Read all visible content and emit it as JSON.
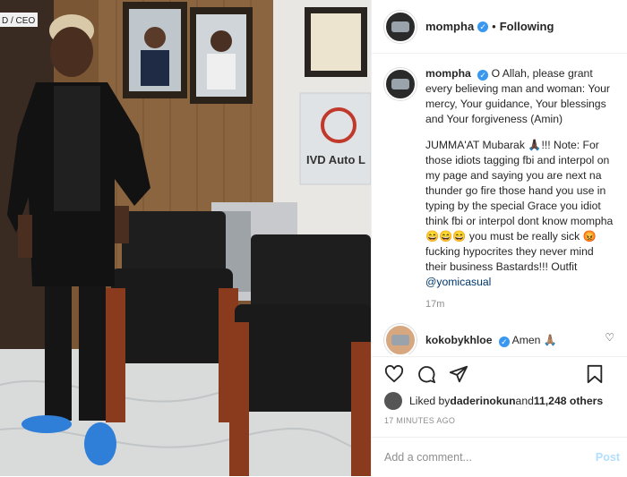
{
  "photo": {
    "sign_text": "IVD Auto L",
    "door_label": "D / CEO"
  },
  "header": {
    "username": "mompha",
    "dot": "•",
    "follow_status": "Following"
  },
  "caption": {
    "username": "mompha",
    "paragraph1": "O Allah, please grant every believing man and woman: Your mercy, Your guidance, Your blessings and Your forgiveness (Amin)",
    "paragraph2_start": "JUMMA'AT Mubarak 🙏🏿!!! Note: For those idiots tagging fbi and interpol on my page and saying you are next na thunder go fire those hand you use in typing by the special Grace you idiot think fbi or interpol dont know mompha 😄😄😄 you must be really sick 😡 fucking hypocrites they never mind their business Bastards!!! Outfit ",
    "mention": "@yomicasual",
    "time": "17m"
  },
  "comment": {
    "username": "kokobykhloe",
    "text": "Amen 🙏🏽"
  },
  "likes": {
    "prefix": "Liked by ",
    "first_user": "daderinokun",
    "and": " and ",
    "count": "11,248 others"
  },
  "timestamp": "17 MINUTES AGO",
  "add_comment": {
    "placeholder": "Add a comment...",
    "post_label": "Post"
  },
  "icons": [
    "verified-icon",
    "heart-icon",
    "comment-icon",
    "share-icon",
    "bookmark-icon"
  ],
  "colors": {
    "verified": "#3897f0",
    "mention": "#00376b",
    "post_disabled": "#b2dffc",
    "muted": "#8e8e8e"
  }
}
